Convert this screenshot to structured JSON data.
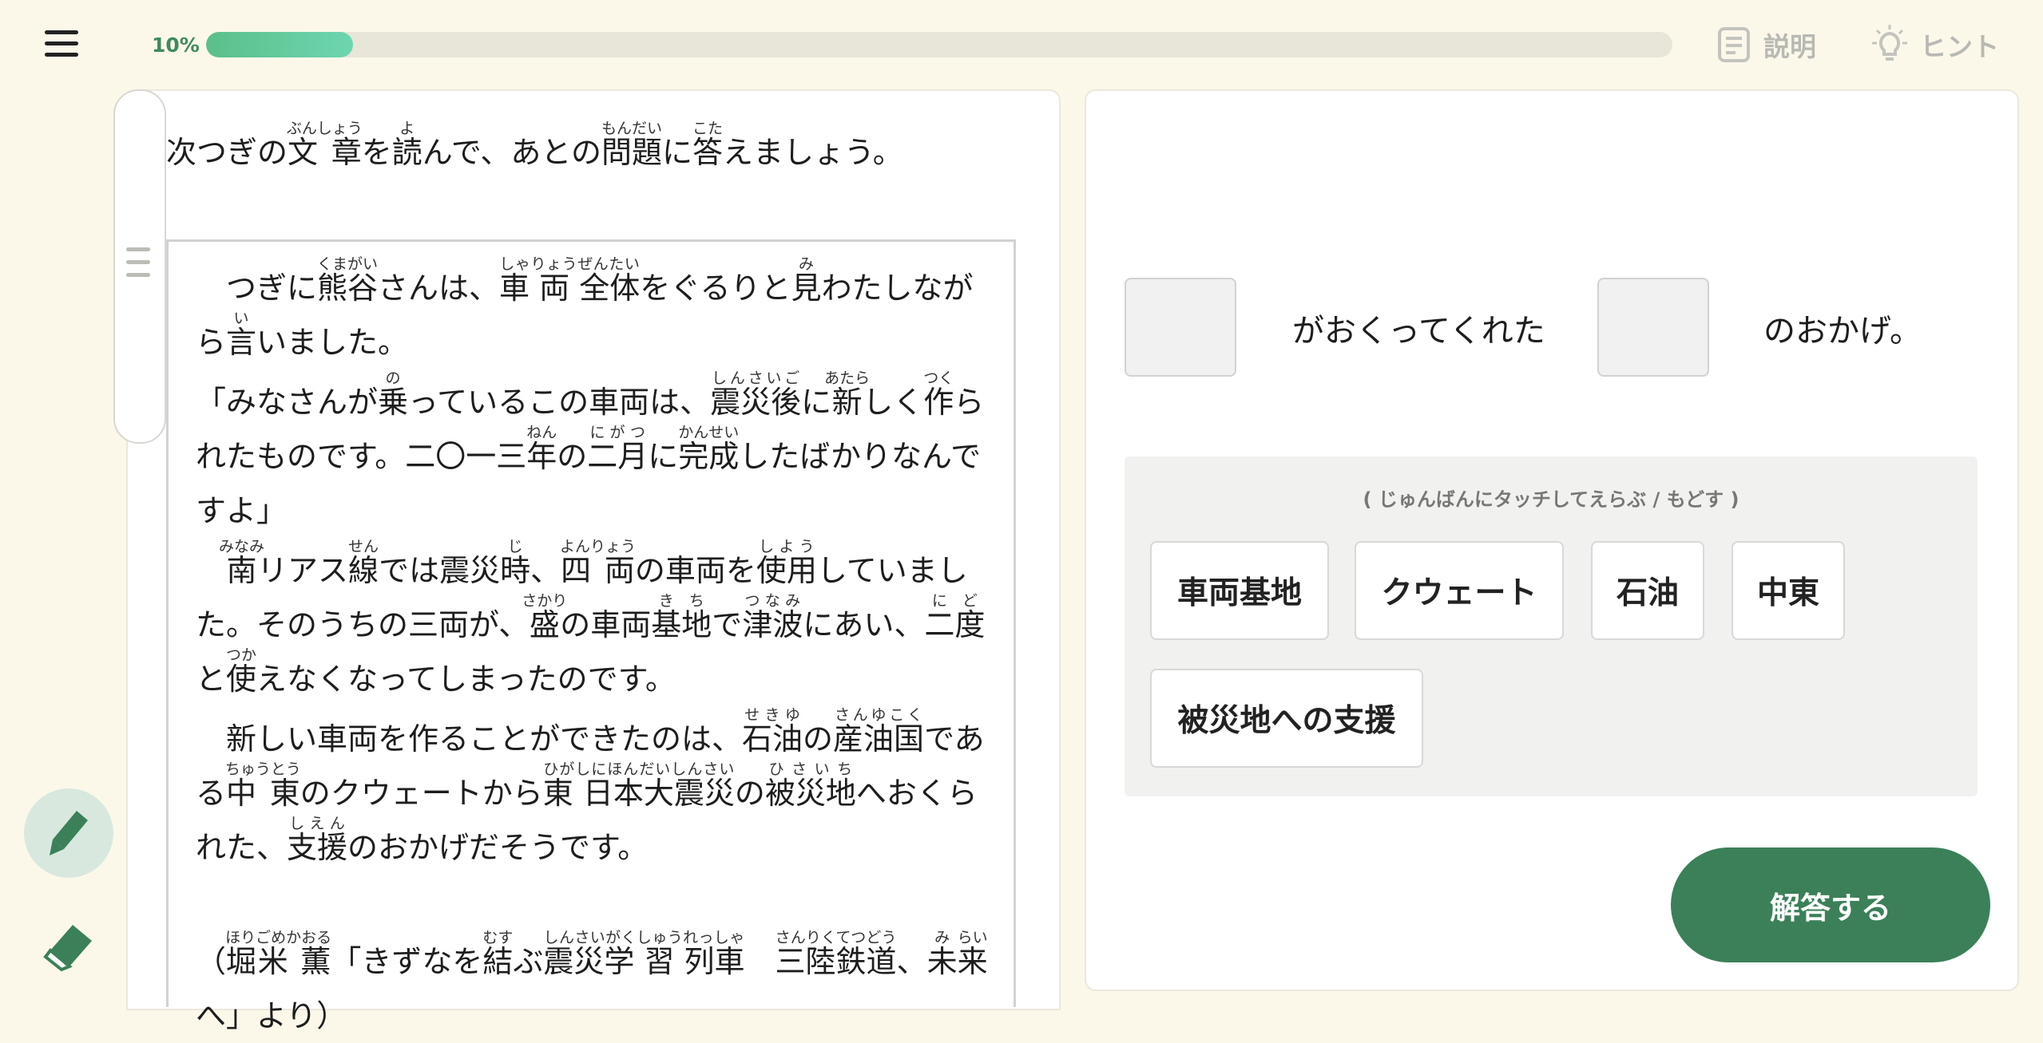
{
  "header": {
    "progress_label": "10%",
    "progress_value": 0.1,
    "explain_label": "説明",
    "hint_label": "ヒント"
  },
  "instruction": {
    "t1": "次",
    "r1": "つぎ",
    "t2": "の",
    "t3": "文 章",
    "r3": "ぶんしょう",
    "t4": "を",
    "t5": "読",
    "r5": "よ",
    "t6": "んで、あとの",
    "t7": "問題",
    "r7": "もんだい",
    "t8": "に",
    "t9": "答",
    "r9": "こた",
    "t10": "えましょう。"
  },
  "passage": {
    "p1": {
      "a": "　つぎに",
      "b": "熊谷",
      "b_r": "くまがい",
      "c": "さんは、",
      "d": "車 両 全体",
      "d_r": "しゃりょうぜんたい",
      "e": "をぐるりと",
      "f": "見",
      "f_r": "み",
      "g": "わたしながら",
      "h": "言",
      "h_r": "い",
      "i": "いました。"
    },
    "p2": {
      "a": "「みなさんが",
      "b": "乗",
      "b_r": "の",
      "c": "っているこの車両は、",
      "d": "震災後",
      "d_r": "しんさいご",
      "e": "に",
      "f": "新",
      "f_r": "あたら",
      "g": "しく",
      "h": "作",
      "h_r": "つく",
      "i": "られたものです。二〇一三",
      "j": "年",
      "j_r": "ねん",
      "k": "の",
      "l": "二月",
      "l_r": "にがつ",
      "m": "に",
      "n": "完成",
      "n_r": "かんせい",
      "o": "したばかりなんですよ」"
    },
    "p3": {
      "a": "　",
      "b": "南",
      "b_r": "みなみ",
      "c": "リアス",
      "d": "線",
      "d_r": "せん",
      "e": "では震災",
      "f": "時",
      "f_r": "じ",
      "g": "、",
      "h": "四 両",
      "h_r": "よんりょう",
      "i": "の車両を",
      "j": "使用",
      "j_r": "しよう",
      "k": "していました。そのうちの三両が、",
      "l": "盛",
      "l_r": "さかり",
      "m": "の車両",
      "n": "基地",
      "n_r": "きち",
      "o": "で",
      "p": "津波",
      "p_r": "つなみ",
      "q": "にあい、",
      "r": "二度",
      "r_r": "にど",
      "s": "と",
      "t": "使",
      "t_r": "つか",
      "u": "えなくなってしまったのです。"
    },
    "p4": {
      "a": "　新しい車両を作ることができたのは、",
      "b": "石油",
      "b_r": "せきゆ",
      "c": "の",
      "d": "産油国",
      "d_r": "さんゆこく",
      "e": "である",
      "f": "中 東",
      "f_r": "ちゅうとう",
      "g": "のクウェートから",
      "h": "東 日本大震災",
      "h_r": "ひがしにほんだいしんさい",
      "i": "の",
      "j": "被災地",
      "j_r": "ひさいち",
      "k": "へおくられた、",
      "l": "支援",
      "l_r": "しえん",
      "m": "のおかげだそうです。"
    },
    "source": {
      "a": "（",
      "b": "堀米 薫",
      "b_r": "ほりごめかおる",
      "c": "「きずなを",
      "d": "結",
      "d_r": "むす",
      "e": "ぶ",
      "f": "震災学 習 列車",
      "f_r": "しんさいがくしゅうれっしゃ",
      "g": "　",
      "h": "三陸鉄道",
      "h_r": "さんりくてつどう",
      "i": "、",
      "j": "未",
      "j_r": "み",
      "k": "来",
      "k_r": "らい",
      "l": "へ」より）"
    }
  },
  "question": {
    "middle": "がおくってくれた",
    "end": "のおかげ。"
  },
  "choices": {
    "hint": "( じゅんばんにタッチしてえらぶ / もどす )",
    "items": [
      "車両基地",
      "クウェート",
      "石油",
      "中東",
      "被災地への支援"
    ]
  },
  "submit_label": "解答する",
  "icons": {
    "menu": "hamburger-icon",
    "explain": "document-icon",
    "hint": "lightbulb-icon",
    "pencil": "pencil-icon",
    "eraser": "eraser-icon"
  },
  "colors": {
    "background": "#fbf8ea",
    "accent": "#3b8059",
    "progress": "#5bbf8a"
  }
}
